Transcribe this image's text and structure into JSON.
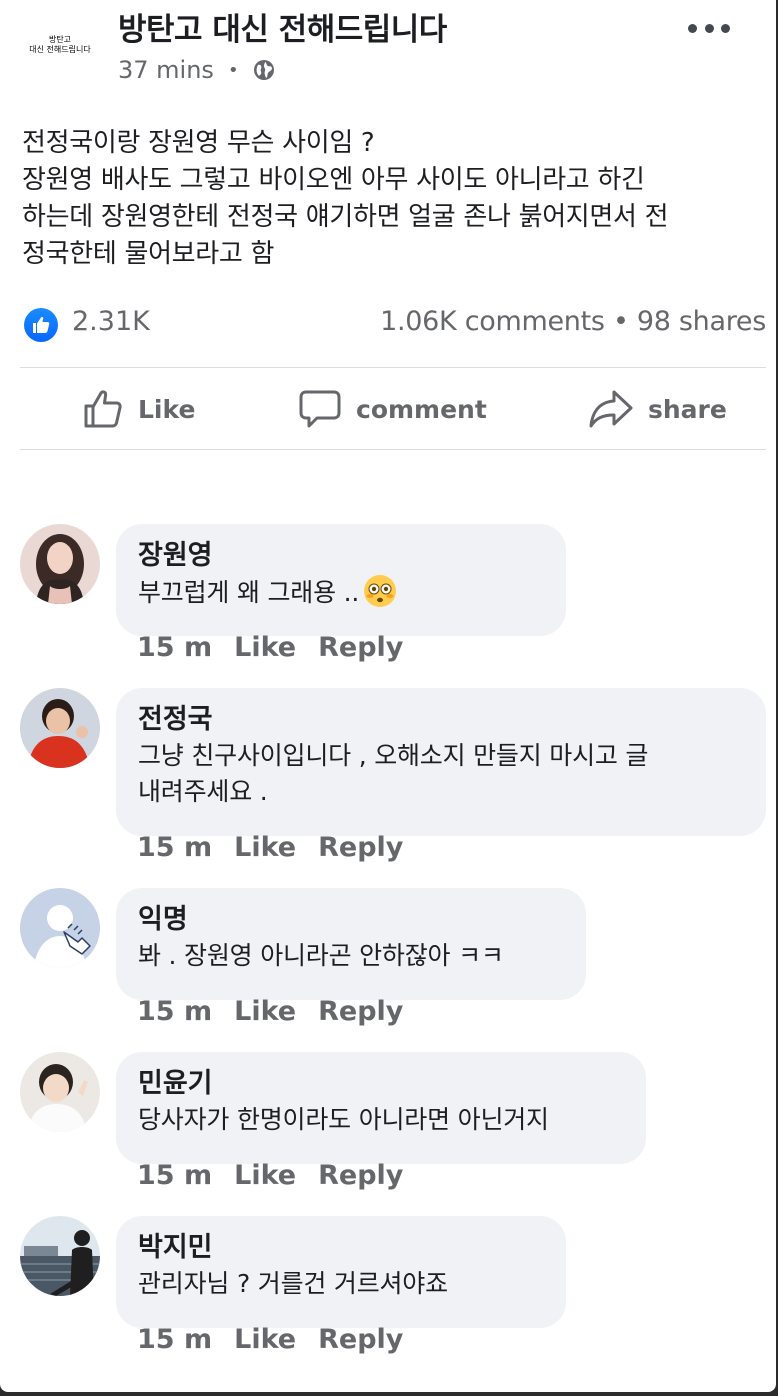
{
  "post": {
    "page_name": "방탄고 대신 전해드립니다",
    "avatar_text_line1": "방탄고",
    "avatar_text_line2": "대신 전해드립니다",
    "time": "37 mins",
    "separator": "•",
    "audience_icon": "globe-icon",
    "more_icon": "more-options-icon",
    "text": "전정국이랑 장원영 무슨 사이임 ?\n장원영 배사도 그렇고 바이오엔 아무 사이도 아니라고 하긴\n하는데 장원영한테 전정국 얘기하면 얼굴 존나 붉어지면서 전\n정국한테 물어보라고 함"
  },
  "stats": {
    "reaction_icon": "like-reaction-icon",
    "reactions": "2.31K",
    "comments_and_shares": "1.06K comments • 98 shares"
  },
  "actions": {
    "like_label": "Like",
    "comment_label": "comment",
    "share_label": "share"
  },
  "colors": {
    "brand_blue": "#0866ff",
    "secondary_text": "#65676b",
    "bubble_bg": "#f0f2f5"
  },
  "comments": [
    {
      "name": "장원영",
      "text": "부끄럽게 왜 그래용 ..",
      "emoji": "flushed-face-emoji",
      "time": "15 m",
      "like": "Like",
      "reply": "Reply"
    },
    {
      "name": "전정국",
      "text": "그냥 친구사이입니다 , 오해소지 만들지 마시고 글\n내려주세요 .",
      "time": "15 m",
      "like": "Like",
      "reply": "Reply"
    },
    {
      "name": "익명",
      "text": "봐 . 장원영 아니라곤 안하잖아 ㅋㅋ",
      "time": "15 m",
      "like": "Like",
      "reply": "Reply"
    },
    {
      "name": "민윤기",
      "text": "당사자가 한명이라도 아니라면 아닌거지",
      "time": "15 m",
      "like": "Like",
      "reply": "Reply"
    },
    {
      "name": "박지민",
      "text": "관리자님 ? 거를건 거르셔야죠",
      "time": "15 m",
      "like": "Like",
      "reply": "Reply"
    }
  ]
}
